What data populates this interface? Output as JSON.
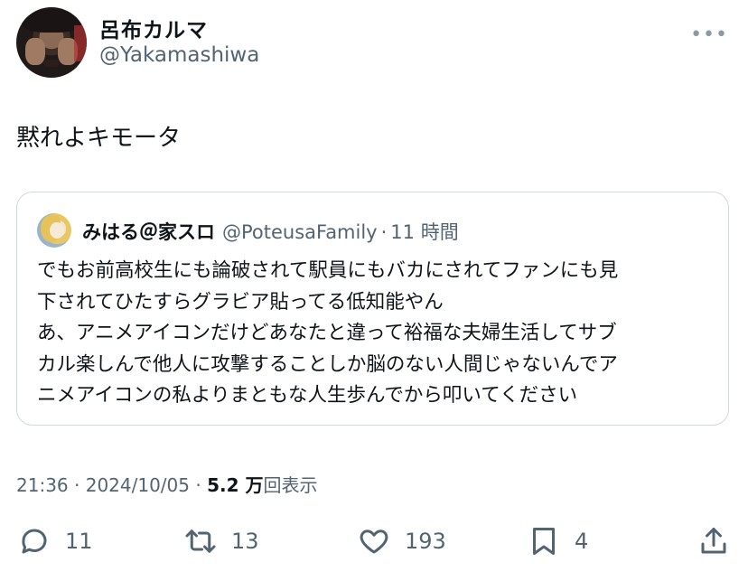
{
  "author": {
    "name": "呂布カルマ",
    "handle": "@Yakamashiwa"
  },
  "more_glyph": "•••",
  "tweet_text": "黙れよキモータ",
  "quoted": {
    "name": "みはる＠家スロ",
    "handle": "@PoteusaFamily",
    "dot": "·",
    "time": "11 時間",
    "text": "でもお前高校生にも論破されて駅員にもバカにされてファンにも見\n下されてひたすらグラビア貼ってる低知能やん\nあ、アニメアイコンだけどあなたと違って裕福な夫婦生活してサブ\nカル楽しんで他人に攻撃することしか脳のない人間じゃないんでア\nニメアイコンの私よりまともな人生歩んでから叩いてください"
  },
  "meta": {
    "time": "21:36",
    "sep1": " · ",
    "date": "2024/10/05",
    "sep2": " · ",
    "views_count": "5.2 万",
    "views_label": "回表示"
  },
  "actions": {
    "reply_count": "11",
    "retweet_count": "13",
    "like_count": "193",
    "bookmark_count": "4"
  },
  "icons": [
    "reply-icon",
    "retweet-icon",
    "heart-icon",
    "bookmark-icon",
    "share-icon"
  ],
  "colors": {
    "text": "#0f1419",
    "muted": "#536471",
    "border": "#cfd9de"
  }
}
